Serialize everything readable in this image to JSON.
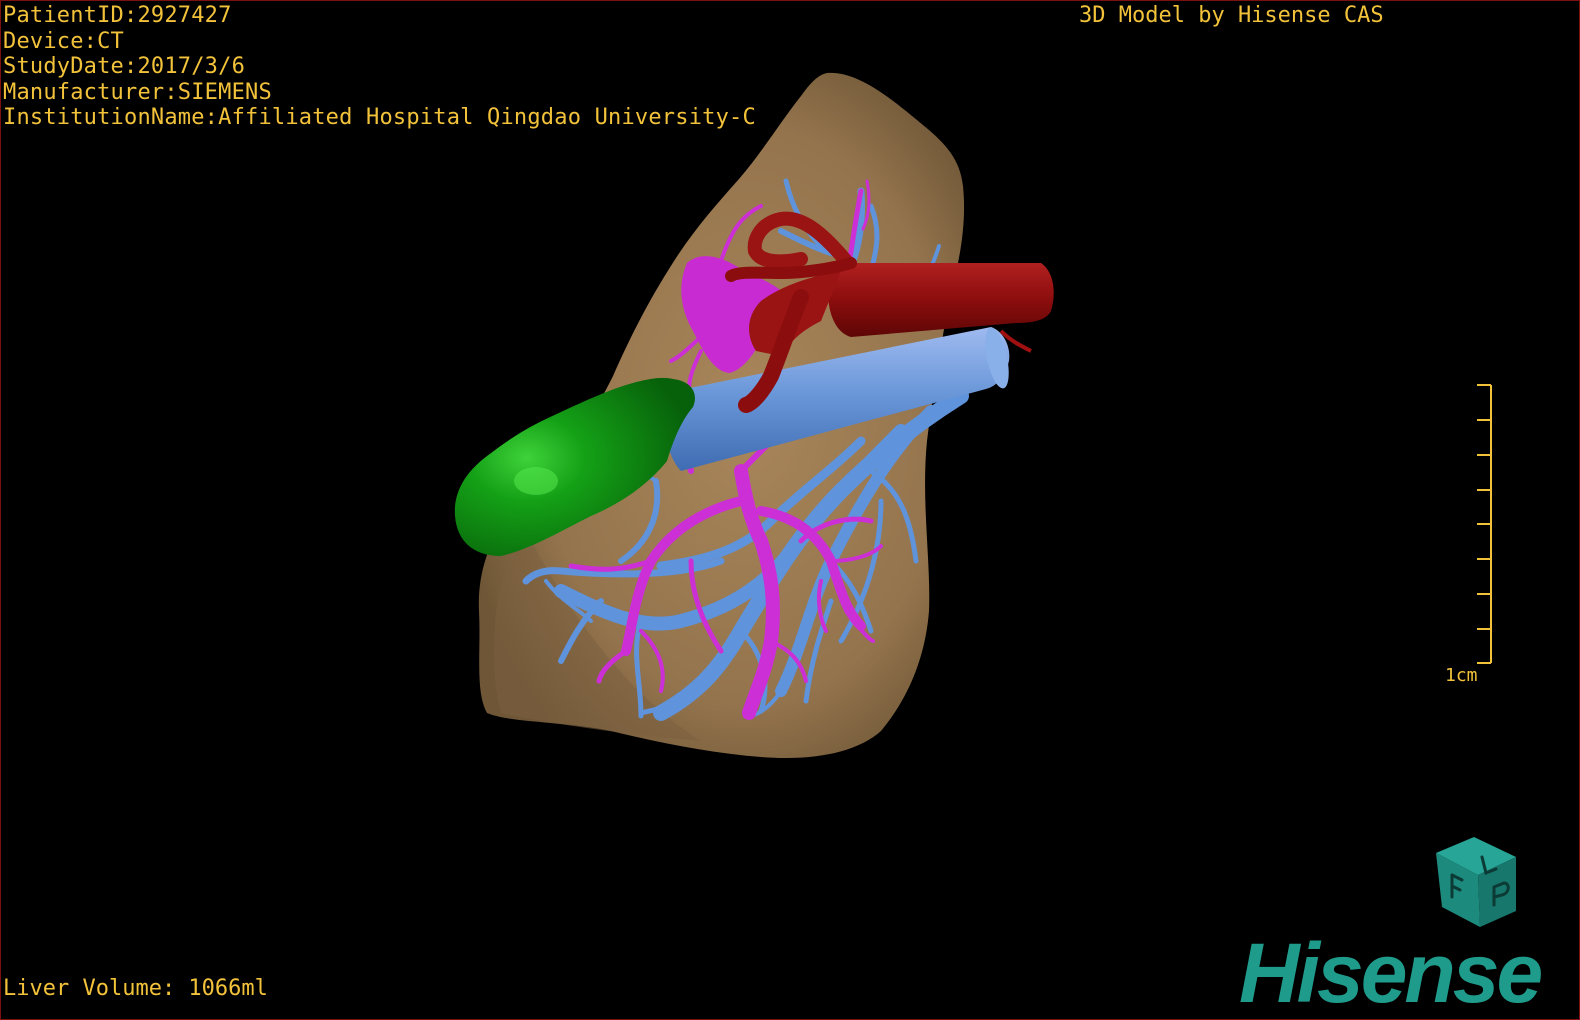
{
  "dicom_info": {
    "patient_id": "PatientID:2927427",
    "device": "Device:CT",
    "study_date": "StudyDate:2017/3/6",
    "manufacturer": "Manufacturer:SIEMENS",
    "institution": "InstitutionName:Affiliated Hospital Qingdao University-C"
  },
  "credit": "3D Model by Hisense CAS",
  "liver_volume": "Liver Volume: 1066ml",
  "scale_bar": {
    "label": "1cm"
  },
  "logo": {
    "text": "Hisense"
  },
  "orientation_cube": {
    "faces": [
      "F",
      "L",
      "P"
    ]
  },
  "colors": {
    "overlay_text": "#f2c23a",
    "background": "#000000",
    "liver": "#9b7a52",
    "portal_vein": "#cc2fd6",
    "hepatic_vein": "#5f93db",
    "vena_cava": "#6b98d9",
    "artery": "#8c0d0d",
    "tumor": "#0e8d12",
    "brand": "#1f9b8c"
  },
  "icons": [
    "orientation-cube-icon",
    "scale-bar-icon"
  ]
}
